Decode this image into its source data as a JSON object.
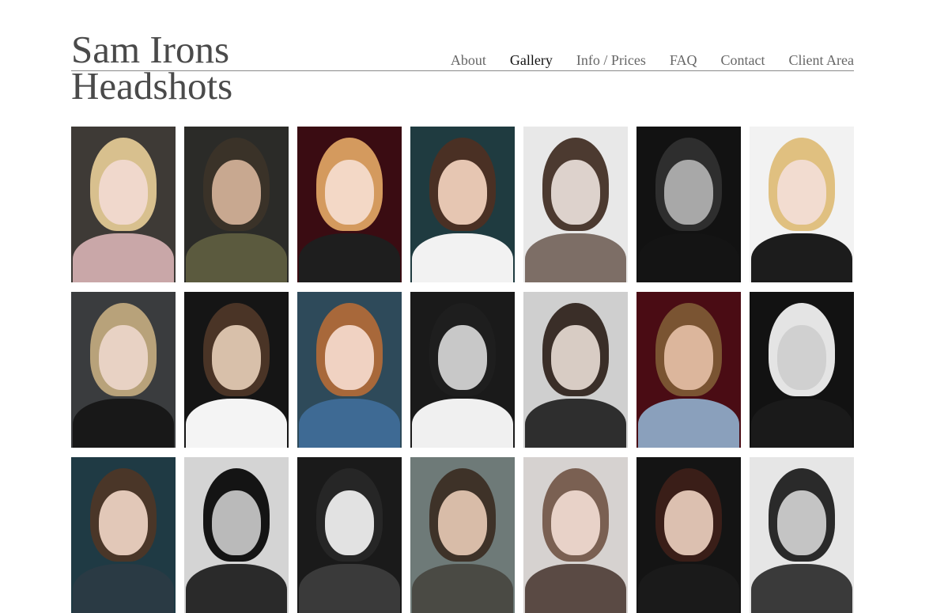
{
  "site": {
    "title_line1": "Sam Irons",
    "title_line2": "Headshots"
  },
  "nav": [
    {
      "label": "About",
      "active": false
    },
    {
      "label": "Gallery",
      "active": true
    },
    {
      "label": "Info / Prices",
      "active": false
    },
    {
      "label": "FAQ",
      "active": false
    },
    {
      "label": "Contact",
      "active": false
    },
    {
      "label": "Client Area",
      "active": false
    }
  ],
  "gallery": [
    {
      "bg": "#3e3a36",
      "hair": "#d8c08e",
      "skin": "#f0d8cc",
      "body": "#c9a7a8"
    },
    {
      "bg": "#2b2b28",
      "hair": "#3a3228",
      "skin": "#c8a890",
      "body": "#5b5a3e"
    },
    {
      "bg": "#3a0c12",
      "hair": "#d49a5e",
      "skin": "#f3d8c6",
      "body": "#1e1e1e"
    },
    {
      "bg": "#1f3b40",
      "hair": "#4a3024",
      "skin": "#e6c6b2",
      "body": "#f2f2f2"
    },
    {
      "bg": "#e8e8e8",
      "hair": "#4c3a30",
      "skin": "#ddd2cc",
      "body": "#7d6e66"
    },
    {
      "bg": "#121212",
      "hair": "#2e2e2e",
      "skin": "#a8a8a8",
      "body": "#141414"
    },
    {
      "bg": "#f2f2f2",
      "hair": "#e0c080",
      "skin": "#f2dcd0",
      "body": "#1c1c1c"
    },
    {
      "bg": "#3a3c3e",
      "hair": "#b8a27a",
      "skin": "#e8d2c4",
      "body": "#181818"
    },
    {
      "bg": "#151515",
      "hair": "#4a3426",
      "skin": "#d8c0aa",
      "body": "#f4f4f4"
    },
    {
      "bg": "#2e4a5a",
      "hair": "#a8683a",
      "skin": "#f0d2c2",
      "body": "#3e6a94"
    },
    {
      "bg": "#1a1a1a",
      "hair": "#1e1e1e",
      "skin": "#c8c8c8",
      "body": "#f0f0f0"
    },
    {
      "bg": "#cfcfcf",
      "hair": "#3a2e28",
      "skin": "#d8ccc4",
      "body": "#2e2e2e"
    },
    {
      "bg": "#4a0c14",
      "hair": "#7a5432",
      "skin": "#dcb69c",
      "body": "#8aa0bc"
    },
    {
      "bg": "#121212",
      "hair": "#e4e4e4",
      "skin": "#d0d0d0",
      "body": "#1a1a1a"
    },
    {
      "bg": "#1f3a44",
      "hair": "#4a3628",
      "skin": "#e2c8b8",
      "body": "#2a3a44"
    },
    {
      "bg": "#d4d4d4",
      "hair": "#141414",
      "skin": "#bababa",
      "body": "#2a2a2a"
    },
    {
      "bg": "#1a1a1a",
      "hair": "#262626",
      "skin": "#e2e2e2",
      "body": "#3a3a3a"
    },
    {
      "bg": "#6e7a78",
      "hair": "#3e3228",
      "skin": "#d8bca8",
      "body": "#4a4a44"
    },
    {
      "bg": "#d6d2d0",
      "hair": "#7a6052",
      "skin": "#e8d2c8",
      "body": "#5a4a44"
    },
    {
      "bg": "#141414",
      "hair": "#3a1e18",
      "skin": "#dcc0b0",
      "body": "#1a1a1a"
    },
    {
      "bg": "#e6e6e6",
      "hair": "#2a2a2a",
      "skin": "#c4c4c4",
      "body": "#3a3a3a"
    }
  ]
}
